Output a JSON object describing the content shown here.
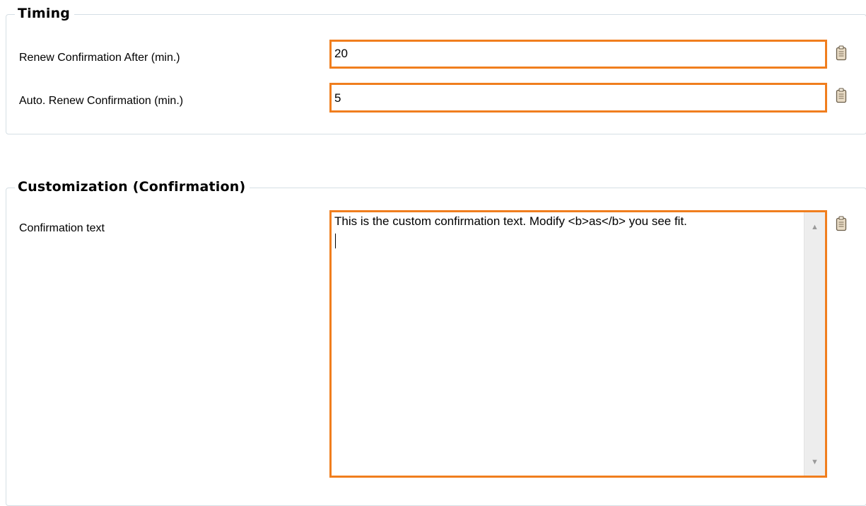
{
  "timing": {
    "title": "Timing",
    "renew_after_label": "Renew Confirmation After (min.)",
    "renew_after_value": "20",
    "auto_renew_label": "Auto. Renew Confirmation (min.)",
    "auto_renew_value": "5"
  },
  "customization": {
    "title": "Customization (Confirmation)",
    "confirmation_text_label": "Confirmation text",
    "confirmation_text_value": "This is the custom confirmation text. Modify <b>as</b> you see fit."
  },
  "icons": {
    "field_action": "clipboard-icon",
    "scroll_up": "chevron-up-icon",
    "scroll_down": "chevron-down-icon"
  },
  "colors": {
    "field_border": "#f07e1e",
    "group_border": "#d5dfe5",
    "scrollbar": "#ededed"
  }
}
